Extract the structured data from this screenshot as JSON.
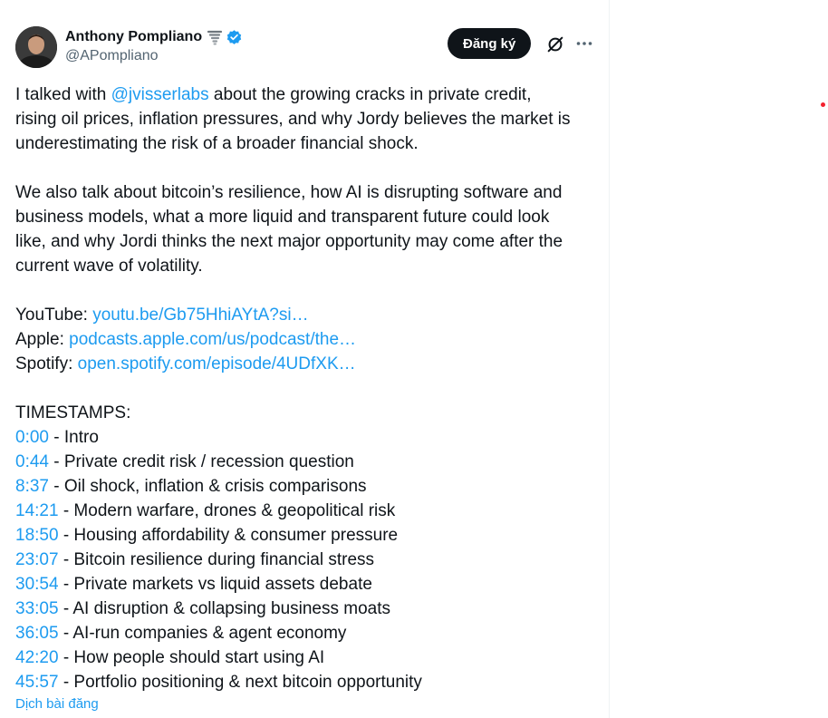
{
  "author": {
    "display_name": "Anthony Pompliano",
    "handle": "@APompliano"
  },
  "actions": {
    "subscribe_label": "Đăng ký"
  },
  "tweet": {
    "p1": {
      "l1_pre": "I talked with ",
      "l1_mention": "@jvisserlabs",
      "l1_post": " about the growing cracks in private credit,",
      "l2": "rising oil prices, inflation pressures, and why Jordy believes the market is",
      "l3": "underestimating the risk of a broader financial shock."
    },
    "p2": {
      "l1": "We also talk about bitcoin’s resilience, how AI is disrupting software and",
      "l2": "business models, what a more liquid and transparent future could look",
      "l3": "like, and why Jordi thinks the next major opportunity may come after the",
      "l4": "current wave of volatility."
    },
    "links": [
      {
        "label": "YouTube: ",
        "url": "youtu.be/Gb75HhiAYtA?si…"
      },
      {
        "label": "Apple: ",
        "url": "podcasts.apple.com/us/podcast/the…"
      },
      {
        "label": "Spotify: ",
        "url": "open.spotify.com/episode/4UDfXK…"
      }
    ],
    "timestamps_heading": "TIMESTAMPS:",
    "timestamps": [
      {
        "time": "0:00",
        "text": " - Intro"
      },
      {
        "time": "0:44",
        "text": " - Private credit risk / recession question"
      },
      {
        "time": "8:37",
        "text": " - Oil shock, inflation & crisis comparisons"
      },
      {
        "time": "14:21",
        "text": " - Modern warfare, drones & geopolitical risk"
      },
      {
        "time": "18:50",
        "text": " - Housing affordability & consumer pressure"
      },
      {
        "time": "23:07",
        "text": " - Bitcoin resilience during financial stress"
      },
      {
        "time": "30:54",
        "text": " - Private markets vs liquid assets debate"
      },
      {
        "time": "33:05",
        "text": " - AI disruption & collapsing business moats"
      },
      {
        "time": "36:05",
        "text": " - AI-run companies & agent economy"
      },
      {
        "time": "42:20",
        "text": " - How people should start using AI"
      },
      {
        "time": "45:57",
        "text": " - Portfolio positioning & next bitcoin opportunity"
      }
    ],
    "translate_label": "Dịch bài đăng"
  },
  "colors": {
    "link": "#1d9bf0",
    "text": "#0f1419",
    "muted": "#536471",
    "verified": "#1d9bf0",
    "notification_dot": "#f4212e"
  },
  "icons": {
    "avatar": "avatar",
    "badge": "tornado-icon",
    "verified": "verified-badge-icon",
    "grok": "grok-icon",
    "more": "more-icon"
  }
}
